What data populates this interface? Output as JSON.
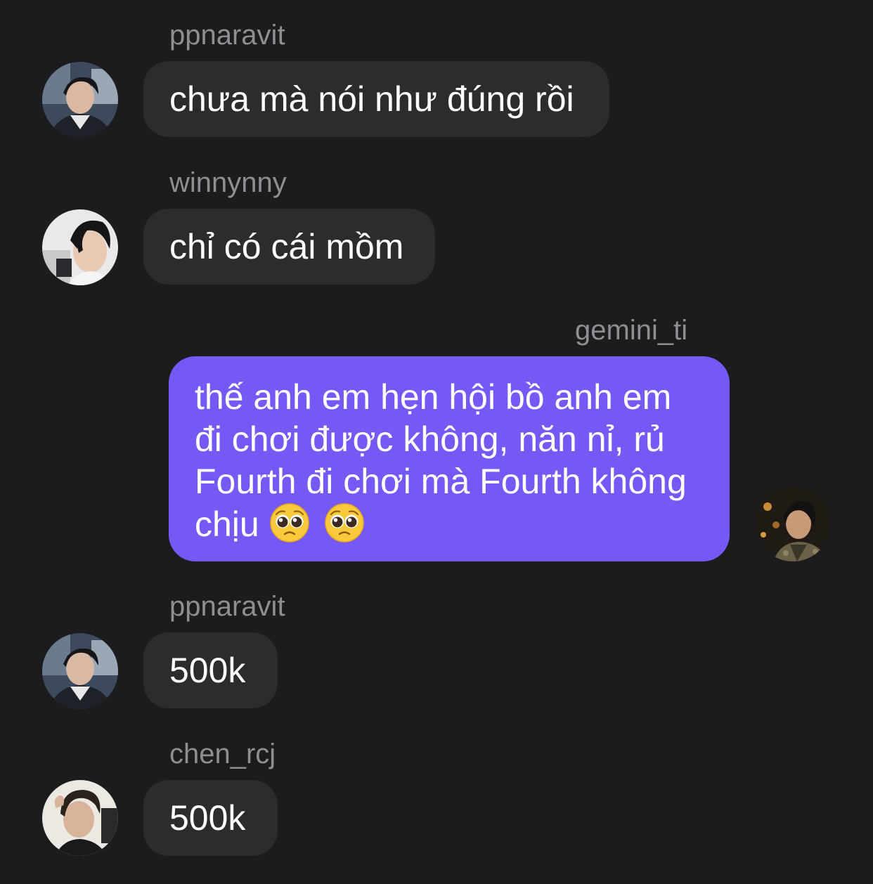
{
  "messages": [
    {
      "username": "ppnaravit",
      "text": "chưa mà nói như đúng rồi",
      "direction": "incoming",
      "avatar": "avatar-ppnaravit"
    },
    {
      "username": "winnynny",
      "text": "chỉ có cái mồm",
      "direction": "incoming",
      "avatar": "avatar-winnynny"
    },
    {
      "username": "gemini_ti",
      "text": "thế anh em hẹn hội bồ anh em đi chơi được không, năn nỉ, rủ Fourth đi chơi mà Fourth không chịu",
      "emojis": [
        "pleading-face-icon",
        "pleading-face-icon"
      ],
      "direction": "outgoing",
      "avatar": "avatar-gemini_ti"
    },
    {
      "username": "ppnaravit",
      "text": "500k",
      "direction": "incoming",
      "avatar": "avatar-ppnaravit"
    },
    {
      "username": "chen_rcj",
      "text": "500k",
      "direction": "incoming",
      "avatar": "avatar-chen_rcj"
    }
  ],
  "colors": {
    "background": "#1c1c1e",
    "incoming_bubble": "#2c2c2e",
    "outgoing_bubble": "#7659f5",
    "username": "#8e8e93",
    "message_text": "#ffffff"
  }
}
